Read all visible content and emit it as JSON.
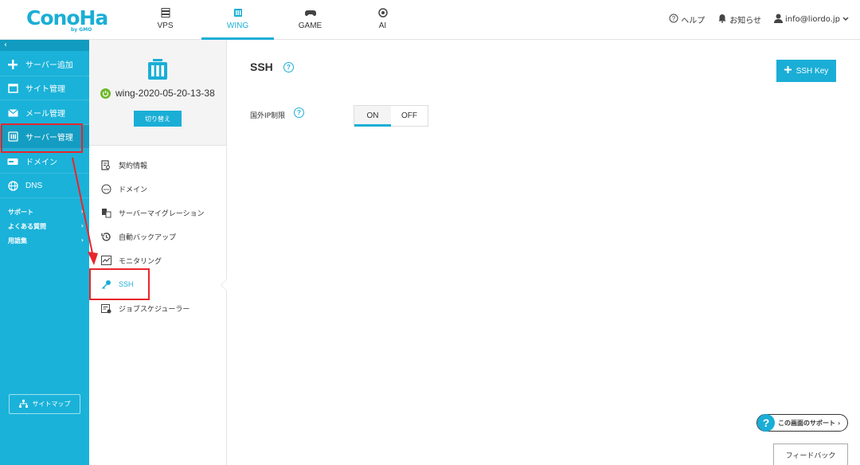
{
  "header": {
    "logo_main": "ConoHa",
    "logo_sub": "by GMO",
    "nav": [
      {
        "label": "VPS",
        "icon": "server-icon"
      },
      {
        "label": "WING",
        "icon": "wing-icon",
        "active": true
      },
      {
        "label": "GAME",
        "icon": "gamepad-icon"
      },
      {
        "label": "AI",
        "icon": "ai-icon"
      }
    ],
    "help": "ヘルプ",
    "notifications": "お知らせ",
    "account": "info@liordo.jp"
  },
  "sidebar": {
    "collapse": "‹",
    "items": [
      {
        "label": "サーバー追加",
        "icon": "plus-icon"
      },
      {
        "label": "サイト管理",
        "icon": "window-icon"
      },
      {
        "label": "メール管理",
        "icon": "mail-icon"
      },
      {
        "label": "サーバー管理",
        "icon": "server-manage-icon",
        "selected": true
      },
      {
        "label": "ドメイン",
        "icon": "domain-icon"
      },
      {
        "label": "DNS",
        "icon": "globe-icon"
      }
    ],
    "links": [
      {
        "label": "サポート",
        "chevron": "›"
      },
      {
        "label": "よくある質問",
        "chevron": "›"
      },
      {
        "label": "用語集",
        "chevron": "›"
      }
    ],
    "sitemap": "サイトマップ"
  },
  "subpanel": {
    "server_name": "wing-2020-05-20-13-38",
    "switch_label": "切り替え",
    "menu": [
      {
        "label": "契約情報",
        "icon": "contract-icon"
      },
      {
        "label": "ドメイン",
        "icon": "www-icon"
      },
      {
        "label": "サーバーマイグレーション",
        "icon": "migration-icon"
      },
      {
        "label": "自動バックアップ",
        "icon": "backup-icon"
      },
      {
        "label": "モニタリング",
        "icon": "monitoring-icon"
      },
      {
        "label": "SSH",
        "icon": "key-icon",
        "active": true
      },
      {
        "label": "ジョブスケジューラー",
        "icon": "scheduler-icon"
      }
    ]
  },
  "main": {
    "title": "SSH",
    "add_key_label": "SSH Key",
    "foreign_ip_label": "国外IP制限",
    "toggle_on": "ON",
    "toggle_off": "OFF",
    "help_glyph": "?"
  },
  "footer": {
    "support_badge": "この画面のサポート",
    "support_glyph": "?",
    "support_chevron": "›",
    "feedback": "フィードバック"
  },
  "colors": {
    "accent": "#1aaed6",
    "sidebar": "#1ab2d9",
    "highlight": "#e8262b",
    "power_on": "#6fb82c"
  }
}
